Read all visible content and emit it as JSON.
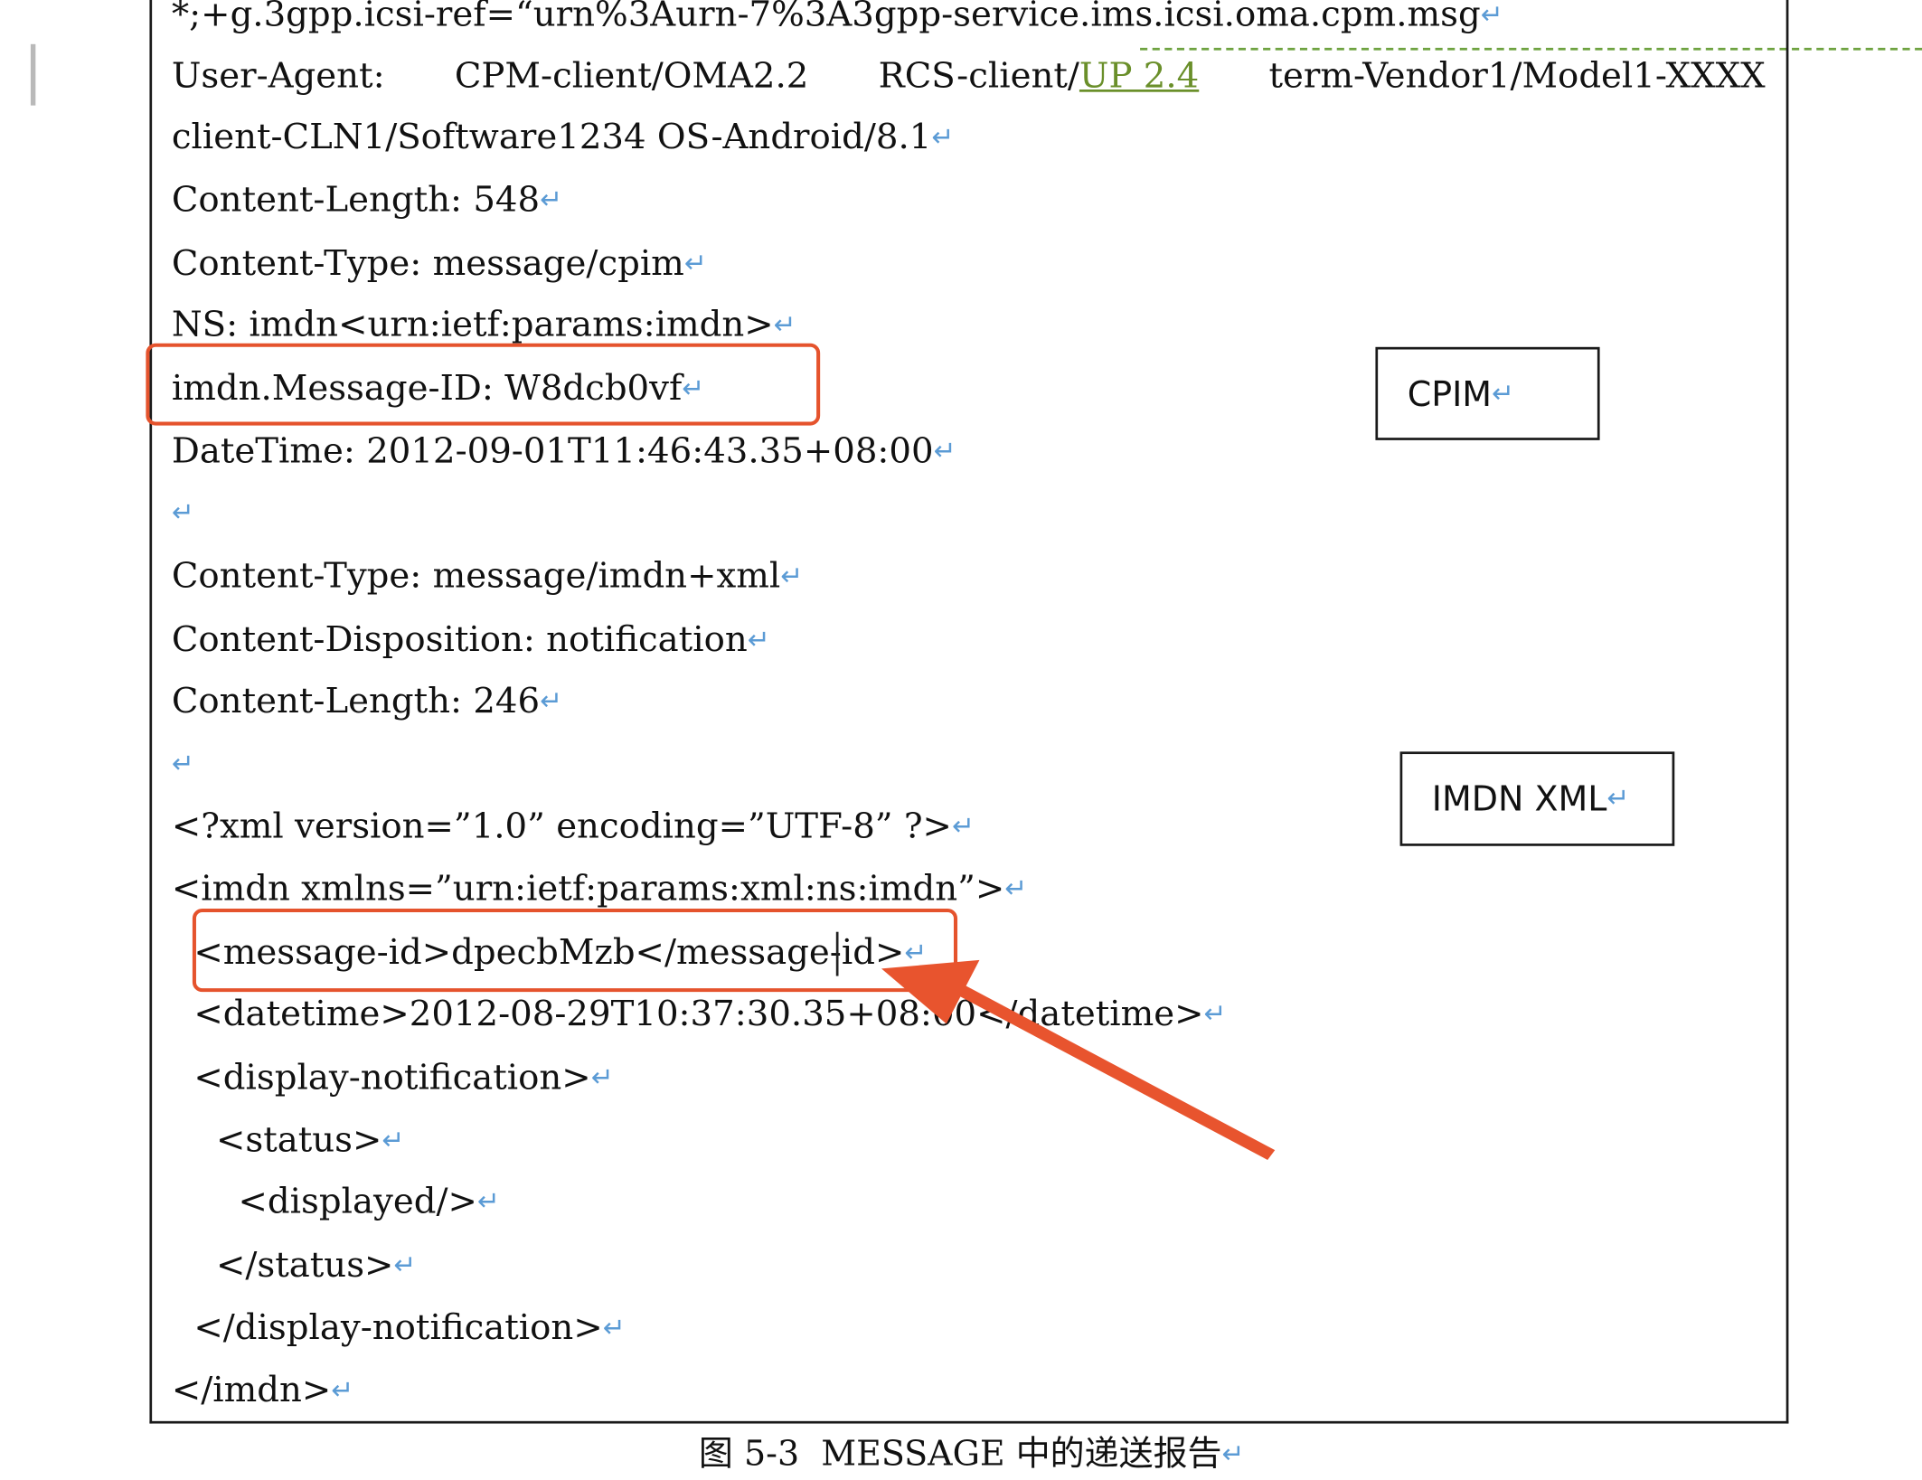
{
  "document": {
    "lines": {
      "l0": "*;+g.3gpp.icsi-ref=“urn%3Aurn-7%3A3gpp-service.ims.icsi.oma.cpm.msg",
      "l2": "client-CLN1/Software1234 OS-Android/8.1",
      "l3": "Content-Length: 548",
      "l4": "Content-Type: message/cpim",
      "l5": "NS: imdn<urn:ietf:params:imdn>",
      "l6": "imdn.Message-ID: W8dcb0vf",
      "l7": "DateTime: 2012-09-01T11:46:43.35+08:00",
      "l9": "Content-Type: message/imdn+xml",
      "l10": "Content-Disposition: notification",
      "l11": "Content-Length: 246",
      "l13": "<?xml version=”1.0” encoding=”UTF-8” ?>",
      "l14": "<imdn xmlns=”urn:ietf:params:xml:ns:imdn”>",
      "l15": "  <message-id>dpecbMzb</message-id>",
      "l16": "  <datetime>2012-08-29T10:37:30.35+08:00</datetime>",
      "l17": "  <display-notification>",
      "l18": "    <status>",
      "l19": "      <displayed/>",
      "l20": "    </status>",
      "l21": "  </display-notification>",
      "l22": "</imdn>"
    },
    "user_agent": {
      "label": "User-Agent:",
      "cpm": "CPM-client/OMA2.2",
      "rcs_prefix": "RCS-client/",
      "rcs_link": "UP 2.4",
      "terminal": "term-Vendor1/Model1-XXXX"
    },
    "paragraph_mark": "↵",
    "annotations": {
      "cpim_label": "CPIM",
      "imdn_xml_label": "IMDN XML"
    },
    "caption": "图 5-3  MESSAGE 中的递送报告"
  },
  "colors": {
    "highlight_box": "#e5532d",
    "arrow": "#e8542e",
    "paragraph_mark": "#5b9bd5",
    "link": "#6a8f2a"
  }
}
